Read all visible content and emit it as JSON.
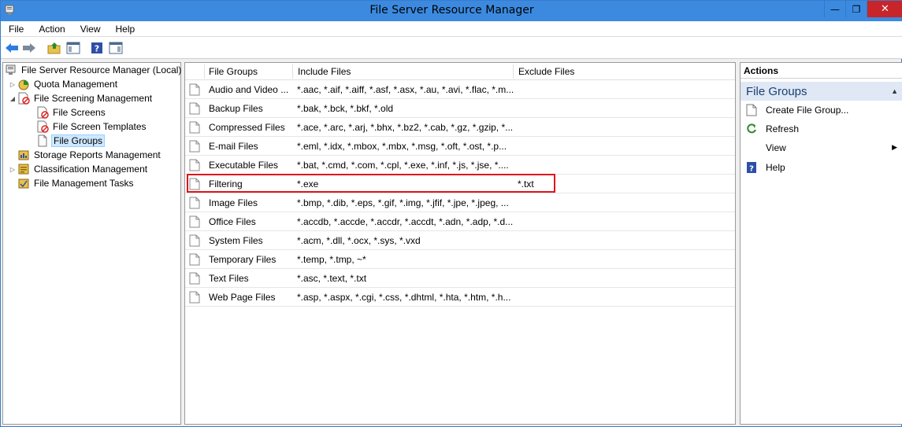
{
  "window": {
    "title": "File Server Resource Manager",
    "close_label": "✕",
    "minimize_label": "—",
    "restore_label": "❐"
  },
  "menu": [
    "File",
    "Action",
    "View",
    "Help"
  ],
  "toolbar": {
    "icons": [
      "back-arrow-icon",
      "forward-arrow-icon",
      "up-folder-icon",
      "show-hide-console-tree-icon",
      "help-icon",
      "show-hide-action-pane-icon"
    ]
  },
  "tree": {
    "root": "File Server Resource Manager (Local)",
    "quota": "Quota Management",
    "screening": "File Screening Management",
    "file_screens": "File Screens",
    "file_screen_templates": "File Screen Templates",
    "file_groups": "File Groups",
    "storage_reports": "Storage Reports Management",
    "classification": "Classification Management",
    "file_mgmt_tasks": "File Management Tasks"
  },
  "table": {
    "columns": [
      "File Groups",
      "Include Files",
      "Exclude Files"
    ],
    "rows": [
      {
        "name": "Audio and Video ...",
        "include": "*.aac, *.aif, *.aiff, *.asf, *.asx, *.au, *.avi, *.flac, *.m...",
        "exclude": ""
      },
      {
        "name": "Backup Files",
        "include": "*.bak, *.bck, *.bkf, *.old",
        "exclude": ""
      },
      {
        "name": "Compressed Files",
        "include": "*.ace, *.arc, *.arj, *.bhx, *.bz2, *.cab, *.gz, *.gzip, *....",
        "exclude": ""
      },
      {
        "name": "E-mail Files",
        "include": "*.eml, *.idx, *.mbox, *.mbx, *.msg, *.oft, *.ost, *.p...",
        "exclude": ""
      },
      {
        "name": "Executable Files",
        "include": "*.bat, *.cmd, *.com, *.cpl, *.exe, *.inf, *.js, *.jse, *....",
        "exclude": ""
      },
      {
        "name": "Filtering",
        "include": "*.exe",
        "exclude": "*.txt"
      },
      {
        "name": "Image Files",
        "include": "*.bmp, *.dib, *.eps, *.gif, *.img, *.jfif, *.jpe, *.jpeg, ...",
        "exclude": ""
      },
      {
        "name": "Office Files",
        "include": "*.accdb, *.accde, *.accdr, *.accdt, *.adn, *.adp, *.d...",
        "exclude": ""
      },
      {
        "name": "System Files",
        "include": "*.acm, *.dll, *.ocx, *.sys, *.vxd",
        "exclude": ""
      },
      {
        "name": "Temporary Files",
        "include": "*.temp, *.tmp, ~*",
        "exclude": ""
      },
      {
        "name": "Text Files",
        "include": "*.asc, *.text, *.txt",
        "exclude": ""
      },
      {
        "name": "Web Page Files",
        "include": "*.asp, *.aspx, *.cgi, *.css, *.dhtml, *.hta, *.htm, *.h...",
        "exclude": ""
      }
    ],
    "highlighted_row": "Filtering"
  },
  "actions": {
    "title": "Actions",
    "group": "File Groups",
    "items": [
      {
        "label": "Create File Group...",
        "icon": "create-file-group-icon"
      },
      {
        "label": "Refresh",
        "icon": "refresh-icon"
      },
      {
        "label": "View",
        "icon": ""
      },
      {
        "label": "Help",
        "icon": "help-icon"
      }
    ]
  },
  "colors": {
    "titlebar": "#3b8ae0",
    "close": "#c7252a",
    "highlight_border": "#e0141e",
    "selected_bg": "#cde8ff"
  }
}
